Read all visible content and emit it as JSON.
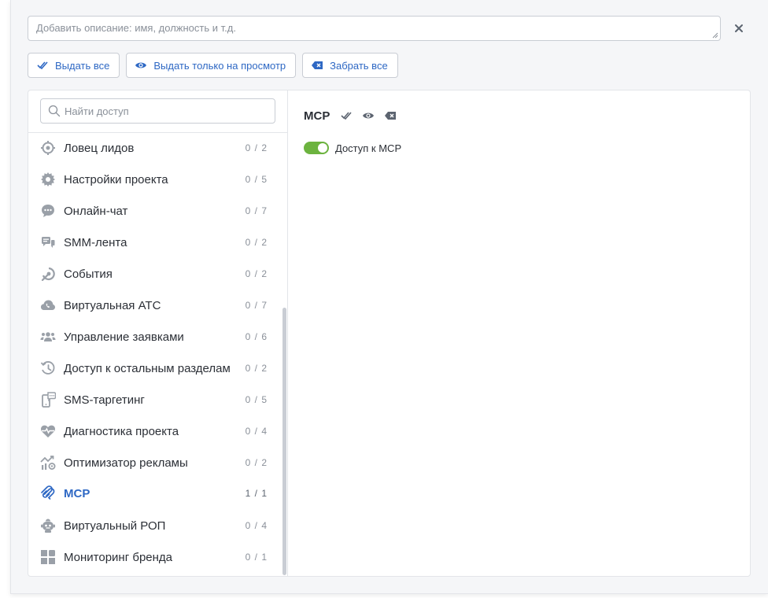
{
  "colors": {
    "accent": "#2e68c4",
    "icon_gray": "#9aa0a8",
    "toggle_on": "#6cb33f"
  },
  "description": {
    "placeholder": "Добавить описание: имя, должность и т.д."
  },
  "actions": {
    "grant_all": "Выдать все",
    "grant_view_only": "Выдать только на просмотр",
    "revoke_all": "Забрать все"
  },
  "search": {
    "placeholder": "Найти доступ"
  },
  "sections": [
    {
      "label": "Ловец лидов",
      "count": "0 / 2",
      "icon": "target-icon"
    },
    {
      "label": "Настройки проекта",
      "count": "0 / 5",
      "icon": "gear-icon"
    },
    {
      "label": "Онлайн-чат",
      "count": "0 / 7",
      "icon": "chat-bubble-icon"
    },
    {
      "label": "SMM-лента",
      "count": "0 / 2",
      "icon": "smm-feed-icon"
    },
    {
      "label": "События",
      "count": "0 / 2",
      "icon": "event-icon"
    },
    {
      "label": "Виртуальная АТС",
      "count": "0 / 7",
      "icon": "cloud-phone-icon"
    },
    {
      "label": "Управление заявками",
      "count": "0 / 6",
      "icon": "users-icon"
    },
    {
      "label": "Доступ к остальным разделам",
      "count": "0 / 2",
      "icon": "history-icon"
    },
    {
      "label": "SMS-таргетинг",
      "count": "0 / 5",
      "icon": "sms-phone-icon"
    },
    {
      "label": "Диагностика проекта",
      "count": "0 / 4",
      "icon": "heart-pulse-icon"
    },
    {
      "label": "Оптимизатор рекламы",
      "count": "0 / 2",
      "icon": "ad-optimizer-icon"
    },
    {
      "label": "MCP",
      "count": "1 / 1",
      "icon": "mcp-icon"
    },
    {
      "label": "Виртуальный РОП",
      "count": "0 / 4",
      "icon": "robot-icon"
    },
    {
      "label": "Мониторинг бренда",
      "count": "0 / 1",
      "icon": "dashboard-icon"
    }
  ],
  "selected": {
    "title": "MCP",
    "permission_label": "Доступ к MCP",
    "permission_enabled": true
  }
}
